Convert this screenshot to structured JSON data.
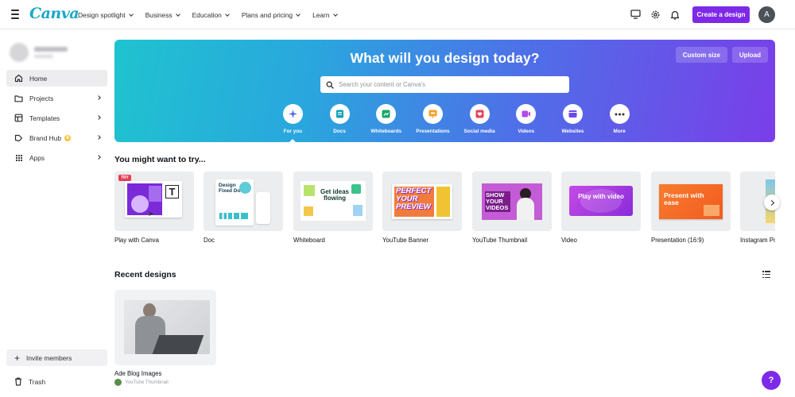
{
  "nav": {
    "logo": "Canva",
    "menu": [
      {
        "label": "Design spotlight"
      },
      {
        "label": "Business"
      },
      {
        "label": "Education"
      },
      {
        "label": "Plans and pricing"
      },
      {
        "label": "Learn"
      }
    ],
    "create_label": "Create a design",
    "avatar_initial": "A",
    "icons": [
      "monitor-icon",
      "gear-icon",
      "bell-icon"
    ]
  },
  "sidebar": {
    "items": [
      {
        "label": "Home",
        "icon": "home-icon"
      },
      {
        "label": "Projects",
        "icon": "folder-icon"
      },
      {
        "label": "Templates",
        "icon": "template-icon"
      },
      {
        "label": "Brand Hub",
        "icon": "brand-icon"
      },
      {
        "label": "Apps",
        "icon": "apps-icon"
      }
    ],
    "invite_label": "Invite members",
    "trash_label": "Trash"
  },
  "hero": {
    "title": "What will you design today?",
    "custom_size_label": "Custom size",
    "upload_label": "Upload",
    "search_placeholder": "Search your content or Canva's",
    "categories": [
      {
        "label": "For you",
        "color": "#ffffff"
      },
      {
        "label": "Docs",
        "color": "#13a3b5"
      },
      {
        "label": "Whiteboards",
        "color": "#1aa66e"
      },
      {
        "label": "Presentations",
        "color": "#f6a225"
      },
      {
        "label": "Social media",
        "color": "#ea3f5d"
      },
      {
        "label": "Videos",
        "color": "#b14be2"
      },
      {
        "label": "Websites",
        "color": "#6a4af0"
      },
      {
        "label": "More",
        "color": "#ffffff"
      }
    ]
  },
  "suggestions": {
    "title": "You might want to try...",
    "try_badge": "TRY",
    "cards": [
      {
        "label": "Play with Canva"
      },
      {
        "label": "Doc",
        "thumb_text": "Design Fixed Docs"
      },
      {
        "label": "Whiteboard",
        "thumb_text": "Get ideas flowing"
      },
      {
        "label": "YouTube Banner",
        "thumb_text": "PERFECT YOUR PREVIEW"
      },
      {
        "label": "YouTube Thumbnail",
        "thumb_text": "SHOW YOUR VIDEOS"
      },
      {
        "label": "Video",
        "thumb_text": "Play with video"
      },
      {
        "label": "Presentation (16:9)",
        "thumb_text": "Present with ease"
      },
      {
        "label": "Instagram Po"
      }
    ]
  },
  "recent": {
    "title": "Recent designs",
    "item_title": "Ade Blog Images",
    "item_sub": "YouTube Thumbnail"
  },
  "help_label": "?"
}
